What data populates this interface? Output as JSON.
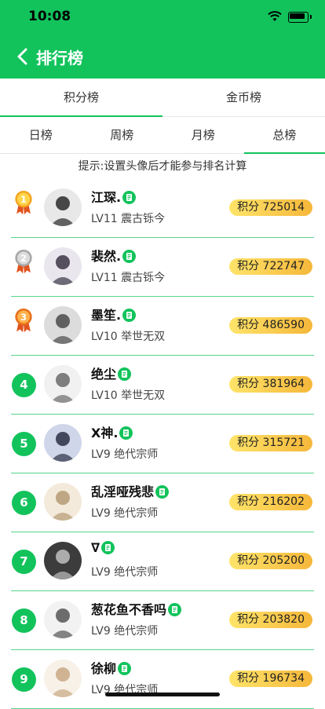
{
  "status": {
    "time": "10:08"
  },
  "nav": {
    "title": "排行榜"
  },
  "tabs_primary": [
    {
      "label": "积分榜",
      "active": true
    },
    {
      "label": "金币榜",
      "active": false
    }
  ],
  "tabs_period": [
    {
      "label": "日榜",
      "active": false
    },
    {
      "label": "周榜",
      "active": false
    },
    {
      "label": "月榜",
      "active": false
    },
    {
      "label": "总榜",
      "active": true
    }
  ],
  "hint": "提示:设置头像后才能参与排名计算",
  "colors": {
    "brand_green": "#12c35c",
    "score_pill_start": "#ffe46a",
    "score_pill_end": "#f5b73a"
  },
  "entries": [
    {
      "rank": "1",
      "name": "江琛.",
      "level": "LV11 震古铄今",
      "score": "积分 725014",
      "medal": "gold"
    },
    {
      "rank": "2",
      "name": "裴然.",
      "level": "LV11 震古铄今",
      "score": "积分 722747",
      "medal": "silver"
    },
    {
      "rank": "3",
      "name": "墨笙.",
      "level": "LV10 举世无双",
      "score": "积分 486590",
      "medal": "bronze"
    },
    {
      "rank": "4",
      "name": "绝尘",
      "level": "LV10 举世无双",
      "score": "积分 381964"
    },
    {
      "rank": "5",
      "name": "X神.",
      "level": "LV9 绝代宗师",
      "score": "积分 315721"
    },
    {
      "rank": "6",
      "name": "乱淫哑残悲",
      "level": "LV9 绝代宗师",
      "score": "积分 216202"
    },
    {
      "rank": "7",
      "name": "∇",
      "level": "LV9 绝代宗师",
      "score": "积分 205200"
    },
    {
      "rank": "8",
      "name": "葱花鱼不香吗",
      "level": "LV9 绝代宗师",
      "score": "积分 203820"
    },
    {
      "rank": "9",
      "name": "徐柳",
      "level": "LV9 绝代宗师",
      "score": "积分 196734"
    }
  ]
}
